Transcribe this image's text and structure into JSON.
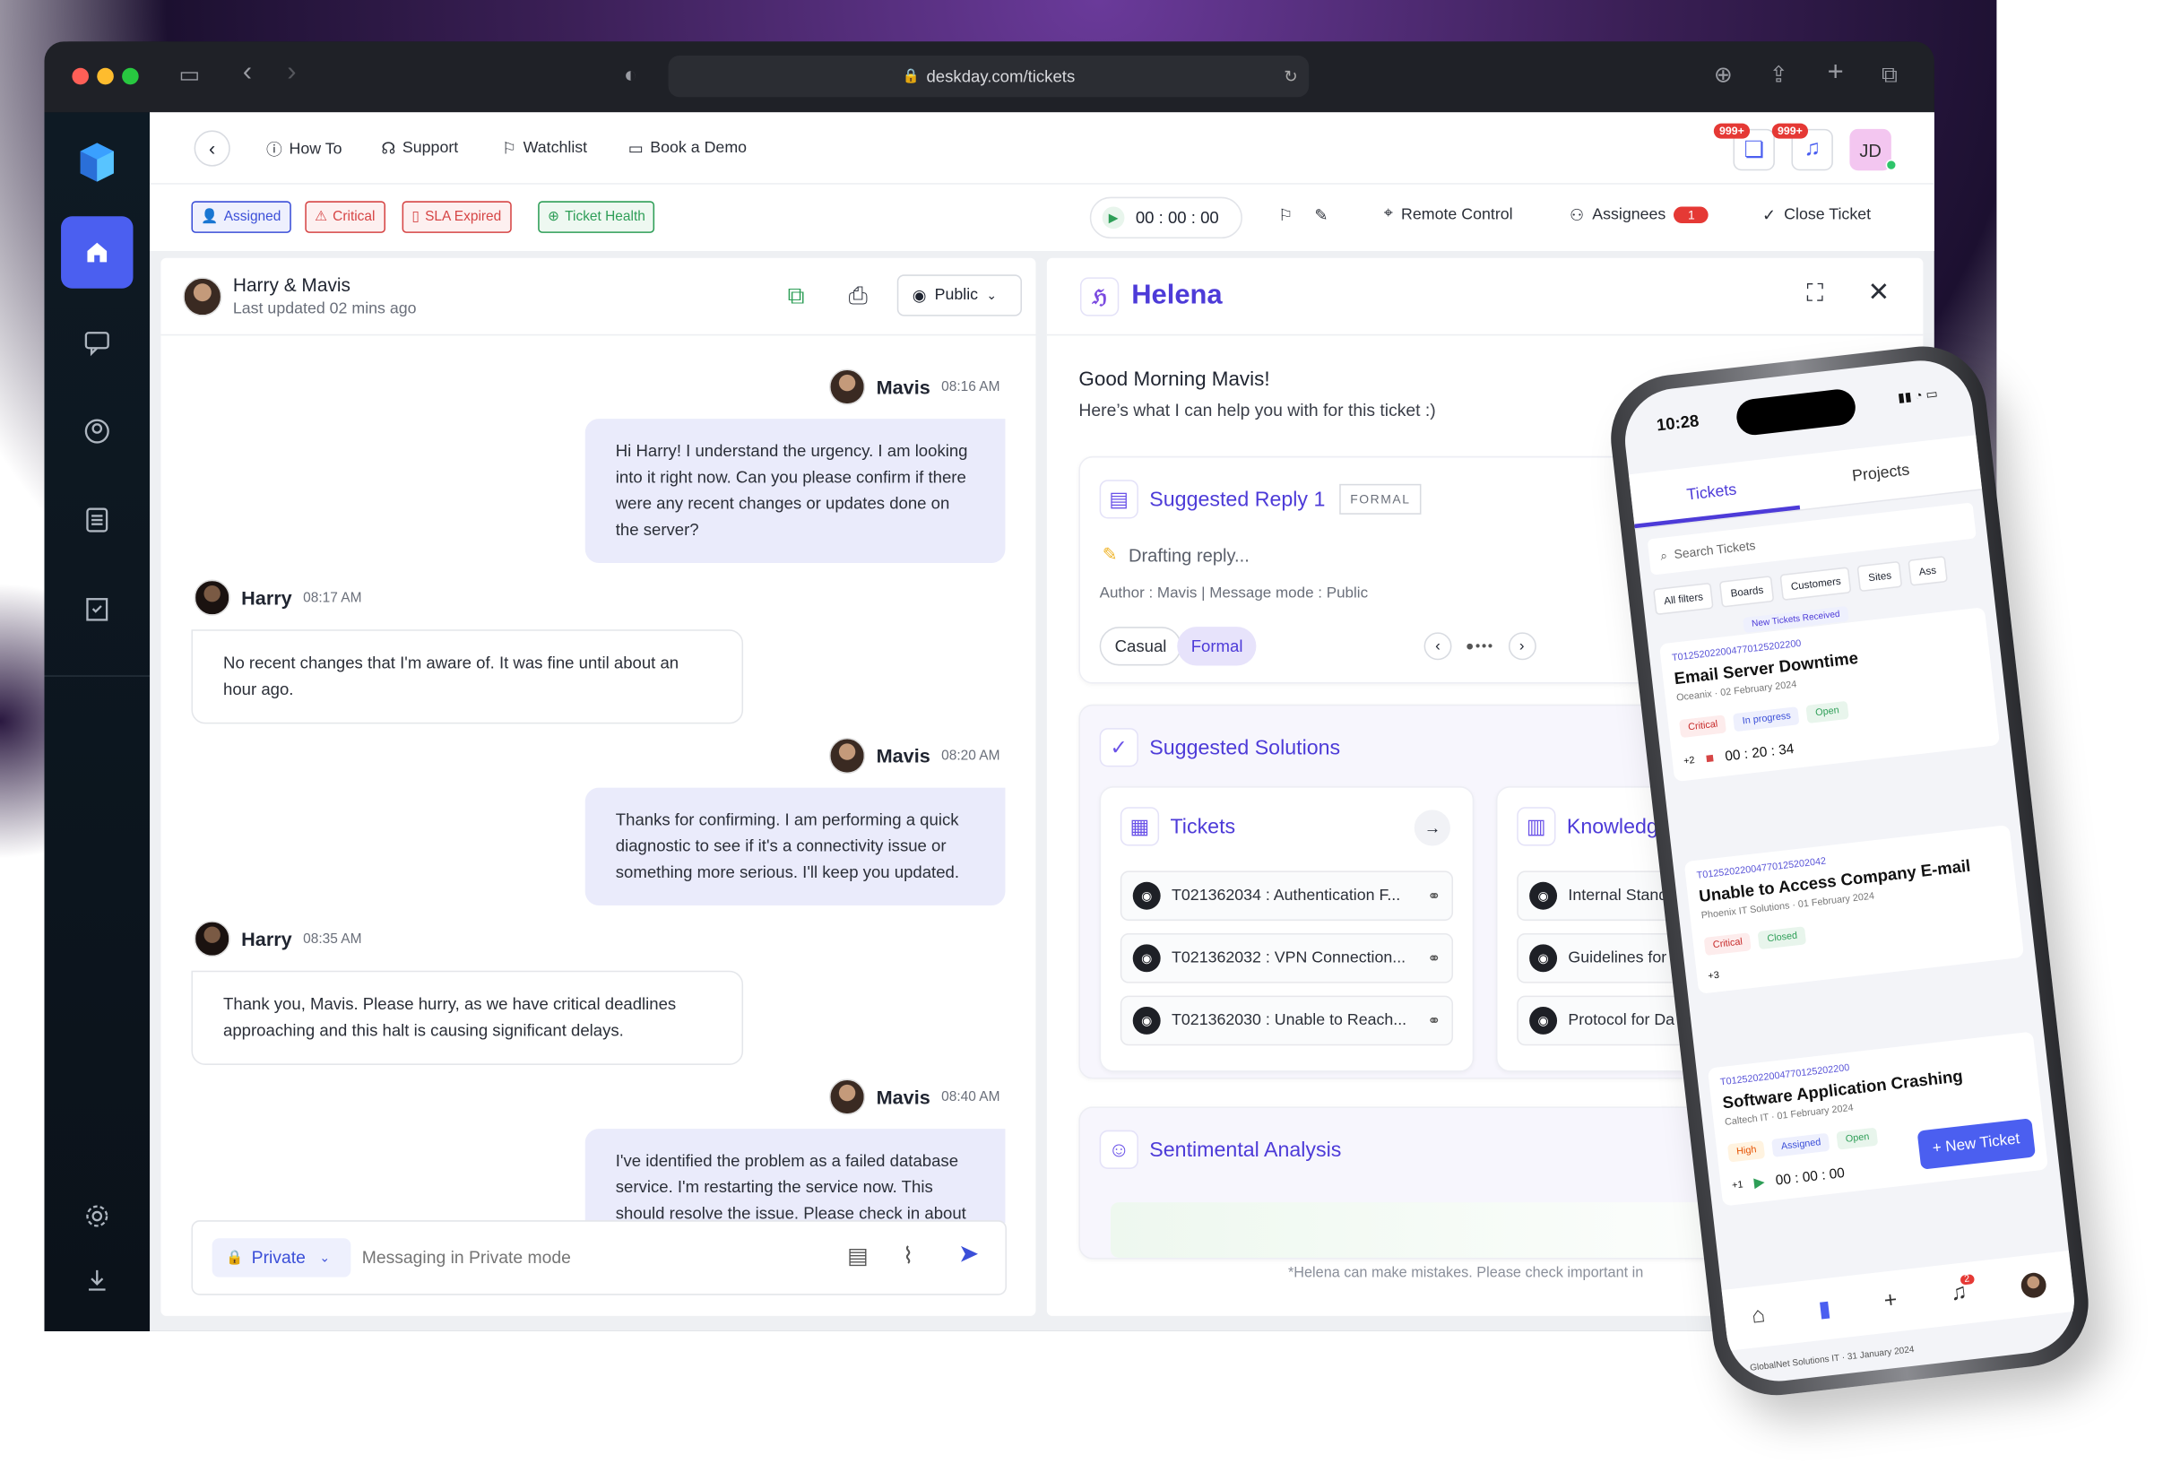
{
  "browser": {
    "url": "deskday.com/tickets"
  },
  "topnav": {
    "links": [
      {
        "label": "How To",
        "icon": "help-circle-icon"
      },
      {
        "label": "Support",
        "icon": "headset-icon"
      },
      {
        "label": "Watchlist",
        "icon": "bookmark-icon"
      },
      {
        "label": "Book a Demo",
        "icon": "video-icon"
      }
    ],
    "chat_badge": "999+",
    "bell_badge": "999+",
    "user_initials": "JD"
  },
  "tags": [
    {
      "label": "Assigned",
      "color": "#3b4fd8"
    },
    {
      "label": "Critical",
      "color": "#d64545"
    },
    {
      "label": "SLA Expired",
      "color": "#d64545"
    },
    {
      "label": "Ticket Health",
      "color": "#2e9e57"
    }
  ],
  "toolbar": {
    "timer": "00 : 00 : 00",
    "remote_control": "Remote Control",
    "assignees": "Assignees",
    "assignees_count": "1",
    "close_ticket": "Close Ticket"
  },
  "chat": {
    "title": "Harry & Mavis",
    "subtitle": "Last updated 02 mins ago",
    "visibility": "Public",
    "messages": [
      {
        "sender": "Mavis",
        "time": "08:16 AM",
        "text": "Hi Harry! I understand the urgency. I am looking into it right now. Can you please confirm if there were any recent changes or updates done on the server?"
      },
      {
        "sender": "Harry",
        "time": "08:17 AM",
        "text": "No recent changes that I'm aware of. It was fine until about an hour ago."
      },
      {
        "sender": "Mavis",
        "time": "08:20 AM",
        "text": "Thanks for confirming. I am performing a quick diagnostic to see if it's a connectivity issue or something more serious. I'll keep you updated."
      },
      {
        "sender": "Harry",
        "time": "08:35 AM",
        "text": "Thank you, Mavis. Please hurry, as we have critical deadlines approaching and this halt is causing significant delays."
      },
      {
        "sender": "Mavis",
        "time": "08:40 AM",
        "text": "I've identified the problem as a failed database service. I'm restarting the service now. This should resolve the issue. Please check in about"
      }
    ],
    "composer_mode": "Private",
    "composer_placeholder": "Messaging in Private mode"
  },
  "helena": {
    "name": "Helena",
    "greeting": "Good Morning Mavis!",
    "intro": "Here’s what I can help you with for this ticket :)",
    "suggested_reply": {
      "title": "Suggested Reply 1",
      "badge": "FORMAL",
      "status": "Drafting reply...",
      "meta": "Author : Mavis | Message mode : Public",
      "tones": [
        "Casual",
        "Formal"
      ],
      "selected_tone": "Formal"
    },
    "suggested_solutions": {
      "title": "Suggested Solutions",
      "tickets_title": "Tickets",
      "tickets": [
        "T021362034 : Authentication F...",
        "T021362032 : VPN Connection...",
        "T021362030 : Unable to Reach..."
      ],
      "knowledge_title": "Knowledge",
      "knowledge": [
        "Internal Standa",
        "Guidelines for S",
        "Protocol for Da"
      ]
    },
    "sentimental_analysis": {
      "title": "Sentimental Analysis"
    },
    "disclaimer": "*Helena can make mistakes. Please check important in"
  },
  "phone": {
    "time": "10:28",
    "tabs": [
      "Tickets",
      "Projects"
    ],
    "search_placeholder": "Search Tickets",
    "filters": [
      "All filters",
      "Boards",
      "Customers",
      "Sites",
      "Ass"
    ],
    "new_tickets": "New Tickets Received",
    "tickets": [
      {
        "id": "T01252022004770125202200",
        "title": "Email Server Downtime",
        "company": "Oceanix",
        "date": "02 February 2024",
        "priority": "Critical",
        "status": "In progress",
        "state": "Open",
        "timer": "00 : 20 : 34",
        "more": "+2"
      },
      {
        "id": "T01252022004770125202042",
        "title": "Unable to Access Company E-mail",
        "company": "Phoenix IT Solutions",
        "date": "01 February 2024",
        "priority": "Critical",
        "state": "Closed",
        "more": "+3"
      },
      {
        "id": "T01252022004770125202200",
        "title": "Software Application Crashing",
        "company": "Caltech IT",
        "date": "01 February 2024",
        "priority": "High",
        "status": "Assigned",
        "state": "Open",
        "timer": "00 : 00 : 00",
        "more": "+1"
      }
    ],
    "new_ticket_button": "+ New Ticket",
    "footer_company": "GlobalNet Solutions IT",
    "footer_date": "31 January 2024",
    "nav_badge": "2"
  }
}
